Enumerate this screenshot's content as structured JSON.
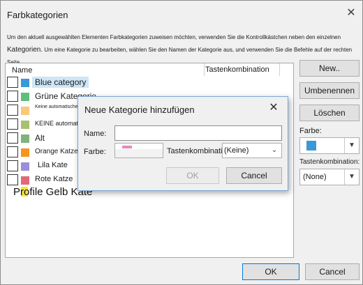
{
  "window": {
    "title": "Farbkategorien"
  },
  "instructions": {
    "line1": "Um den aktuell ausgewählten Elementen Farbkategorien zuweisen möchten, verwenden Sie die Kontrollkästchen neben den einzelnen",
    "line2_big": "Kategorien.",
    "line2_small": " Um eine Kategorie zu bearbeiten, wählen Sie den Namen der Kategorie aus, und verwenden Sie die Befehle auf der rechten Seite."
  },
  "list": {
    "col_name": "Name",
    "col_shortcut": "Tastenkombination",
    "items": [
      {
        "label": "Blue category",
        "color": "#3a98d8",
        "selected": true
      },
      {
        "label": "Grüne Kategorie",
        "color": "#5fbf7a"
      },
      {
        "label": "Keine automatische Kategorie",
        "color": "#f7c97a"
      },
      {
        "label": "KEINE automatische cc",
        "color": "#a8c070"
      },
      {
        "label": "Alt",
        "color": "#7fb27f"
      },
      {
        "label": "Orange Katze",
        "color": "#f7941d"
      },
      {
        "label": "Lila Kate",
        "color": "#9b8fd8"
      },
      {
        "label": "Rote Katze",
        "color": "#e06878"
      }
    ],
    "overflow_label": "Profile Gelb Kate",
    "overflow_color": "#f5e23a"
  },
  "right": {
    "new_label": "New..",
    "rename_label": "Umbenennen",
    "delete_label": "Löschen",
    "color_label": "Farbe:",
    "color_value": "#3a98d8",
    "shortcut_label": "Tastenkombination:",
    "shortcut_value": "(None)"
  },
  "footer": {
    "ok_label": "OK",
    "cancel_label": "Cancel"
  },
  "dialog": {
    "title": "Neue Kategorie hinzufügen",
    "name_label": "Name:",
    "name_value": "",
    "color_label": "Farbe:",
    "color_value": "#e88ab8",
    "shortcut_label": "Tastenkombination:",
    "shortcut_value": "(Keine)",
    "ok_label": "OK",
    "cancel_label": "Cancel"
  }
}
